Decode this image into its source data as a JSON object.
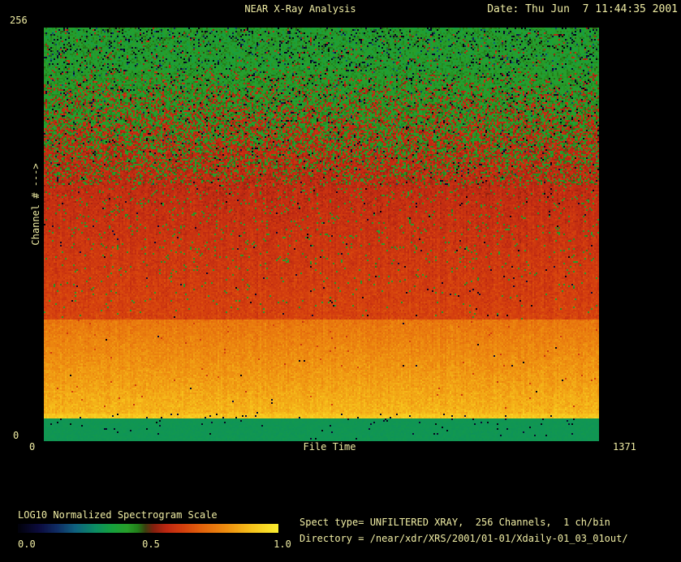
{
  "header": {
    "title": "NEAR X-Ray Analysis",
    "date": "Date: Thu Jun  7 11:44:35 2001"
  },
  "axes": {
    "y_max": "256",
    "y_min": "0",
    "y_label": "Channel # --->",
    "x_min": "0",
    "x_label": "File Time",
    "x_max": "1371"
  },
  "colorbar": {
    "title": "LOG10 Normalized Spectrogram Scale",
    "tick_labels": [
      "0.0",
      "0.5",
      "1.0"
    ]
  },
  "info": {
    "line1": "Spect type= UNFILTERED XRAY,  256 Channels,  1 ch/bin",
    "line2": "Directory = /near/xdr/XRS/2001/01-01/Xdaily-01_03_01out/"
  },
  "colors": {
    "background": "#000000",
    "text": "#f0eda4"
  },
  "chart_data": {
    "type": "heatmap",
    "title": "NEAR X-Ray Analysis",
    "xlabel": "File Time",
    "ylabel": "Channel #",
    "x_range": [
      0,
      1371
    ],
    "y_range": [
      0,
      256
    ],
    "colorbar_label": "LOG10 Normalized Spectrogram Scale",
    "colorbar_range": [
      0.0,
      1.0
    ],
    "colorbar_ticks": [
      0.0,
      0.5,
      1.0
    ],
    "legend_position": "bottom-left",
    "grid": false,
    "pixel_grid": {
      "cols": 342,
      "rows": 255
    },
    "seed": 987654321,
    "colormap_stops": [
      [
        0.0,
        2,
        2,
        12
      ],
      [
        0.08,
        12,
        12,
        62
      ],
      [
        0.15,
        16,
        45,
        100
      ],
      [
        0.22,
        15,
        98,
        128
      ],
      [
        0.3,
        12,
        142,
        98
      ],
      [
        0.36,
        22,
        160,
        62
      ],
      [
        0.42,
        40,
        158,
        42
      ],
      [
        0.46,
        34,
        128,
        26
      ],
      [
        0.49,
        60,
        62,
        16
      ],
      [
        0.52,
        130,
        32,
        14
      ],
      [
        0.57,
        190,
        40,
        18
      ],
      [
        0.63,
        212,
        62,
        14
      ],
      [
        0.7,
        226,
        96,
        12
      ],
      [
        0.8,
        238,
        142,
        16
      ],
      [
        0.9,
        247,
        196,
        28
      ],
      [
        1.0,
        251,
        238,
        48
      ]
    ],
    "bands": [
      {
        "channels": [
          230,
          256
        ],
        "desc": "noisy green, many dark dropouts",
        "f0": 0.0,
        "f1": 0.1,
        "base": [
          0.41,
          0.41
        ],
        "sigma": 0.05,
        "black_p": [
          0.09,
          0.05
        ],
        "blue_p": [
          0.02,
          0.015
        ],
        "alt_p": [
          0.02,
          0.05
        ],
        "alt_v": 0.57,
        "alt_sigma": 0.03,
        "streak": false
      },
      {
        "channels": [
          159,
          230
        ],
        "desc": "green-to-red mixing transition",
        "f0": 0.1,
        "f1": 0.38,
        "base": [
          0.42,
          0.43
        ],
        "sigma": 0.035,
        "black_p": [
          0.05,
          0.012
        ],
        "blue_p": [
          0.012,
          0.002
        ],
        "alt_p": [
          0.06,
          0.82
        ],
        "alt_v": 0.575,
        "alt_sigma": 0.03,
        "streak": false
      },
      {
        "channels": [
          75,
          159
        ],
        "desc": "red zone, sparse green specks",
        "f0": 0.38,
        "f1": 0.708,
        "base": [
          0.578,
          0.64
        ],
        "sigma": 0.026,
        "black_p": [
          0.006,
          0.003
        ],
        "blue_p": [
          0,
          0
        ],
        "alt_p": [
          0.055,
          0.012
        ],
        "alt_v": 0.42,
        "alt_sigma": 0.02,
        "streak": true
      },
      {
        "channels": [
          14,
          75
        ],
        "desc": "bright orange band, brightening downward",
        "f0": 0.708,
        "f1": 0.935,
        "base": [
          0.748,
          0.872
        ],
        "sigma": 0.028,
        "black_p": [
          0.001,
          0.001
        ],
        "blue_p": [
          0,
          0
        ],
        "alt_p": [
          0.006,
          0.002
        ],
        "alt_v": 0.62,
        "alt_sigma": 0.02,
        "streak": true
      },
      {
        "channels": [
          13,
          14
        ],
        "desc": "bright yellow rows",
        "f0": 0.935,
        "f1": 0.947,
        "base": [
          0.895,
          0.91
        ],
        "sigma": 0.025,
        "black_p": [
          0.012,
          0.025
        ],
        "blue_p": [
          0,
          0
        ],
        "alt_p": [
          0,
          0
        ],
        "alt_v": 0.6,
        "alt_sigma": 0.0,
        "streak": true
      },
      {
        "channels": [
          0,
          13
        ],
        "desc": "flat teal band, few black ticks",
        "f0": 0.947,
        "f1": 1.0,
        "base": [
          0.325,
          0.325
        ],
        "sigma": 0.006,
        "black_p": [
          0.025,
          0.004
        ],
        "blue_p": [
          0,
          0
        ],
        "alt_p": [
          0,
          0
        ],
        "alt_v": 0.0,
        "alt_sigma": 0.0,
        "streak": false
      }
    ]
  }
}
